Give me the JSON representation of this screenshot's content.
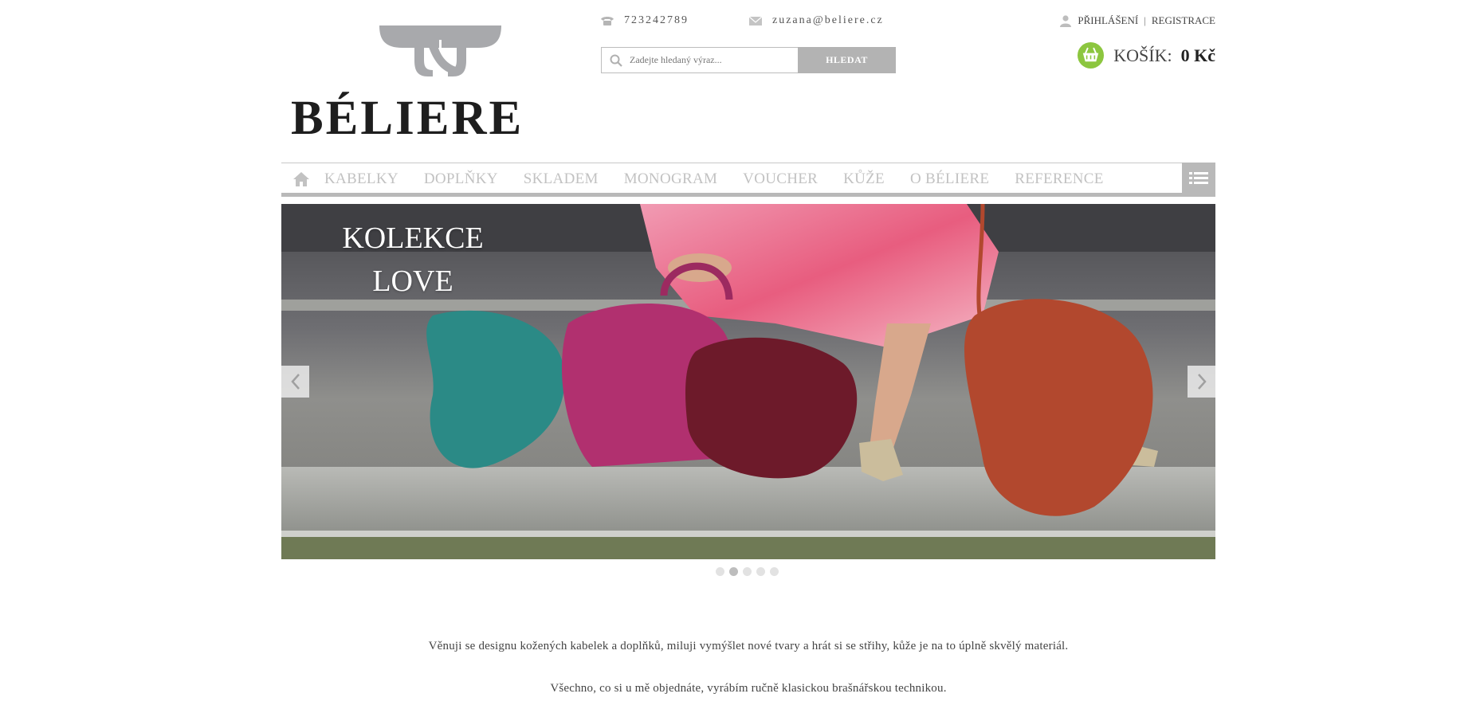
{
  "header": {
    "logo_text": "BÉLIERE",
    "phone": "723242789",
    "email": "zuzana@beliere.cz",
    "phone_icon": "phone-icon",
    "email_icon": "envelope-icon"
  },
  "search": {
    "placeholder": "Zadejte hledaný výraz...",
    "button_label": "HLEDAT"
  },
  "account": {
    "login": "PŘIHLÁŠENÍ",
    "separator": "|",
    "register": "REGISTRACE"
  },
  "cart": {
    "label": "KOŠÍK:",
    "amount": "0 Kč"
  },
  "nav": {
    "items": [
      "KABELKY",
      "DOPLŇKY",
      "SKLADEM",
      "MONOGRAM",
      "VOUCHER",
      "KŮŽE",
      "O BÉLIERE",
      "REFERENCE"
    ]
  },
  "slider": {
    "title_line1": "KOLEKCE",
    "title_line2": "LOVE",
    "slide_count": 5,
    "active_slide": 2
  },
  "content": {
    "paragraph1": "Věnuji se designu kožených kabelek a doplňků, miluji vymýšlet nové tvary a hrát si se střihy, kůže je na to úplně skvělý materiál.",
    "paragraph2": "Všechno, co si u mě objednáte, vyrábím ručně klasickou brašnářskou technikou."
  },
  "colors": {
    "accent_green": "#8cc63f",
    "nav_text": "#c2c2c2",
    "button_gray": "#b3b3b3"
  }
}
